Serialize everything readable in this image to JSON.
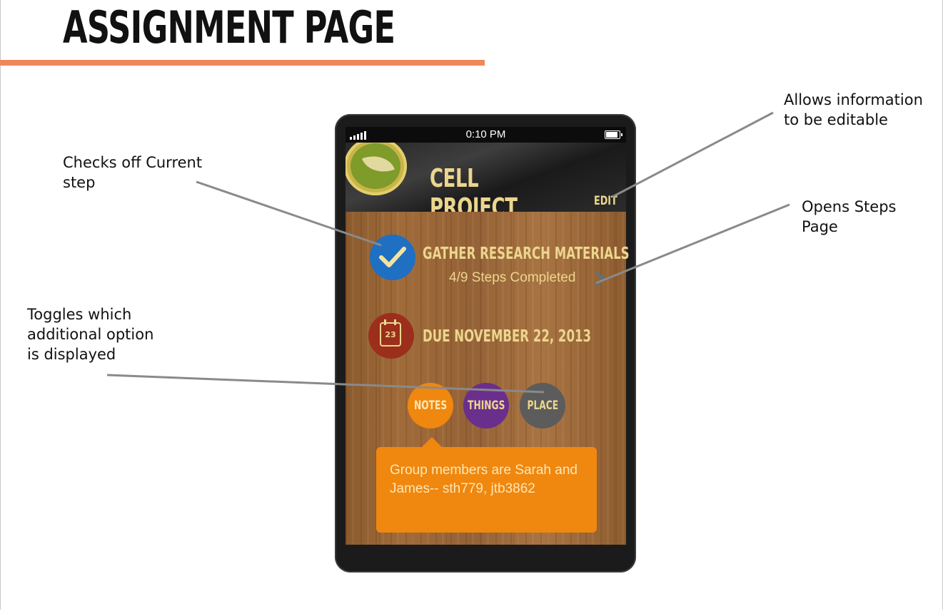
{
  "slide": {
    "title": "ASSIGNMENT PAGE",
    "accent_color": "#f0875a"
  },
  "annotations": {
    "check_step": "Checks off Current\nstep",
    "toggle_options": "Toggles which\nadditional option\nis displayed",
    "edit_info": "Allows information\nto be editable",
    "open_steps": "Opens Steps\nPage"
  },
  "phone": {
    "status_bar": {
      "time": "0:10 PM",
      "icons": [
        "signal-icon",
        "battery-icon"
      ]
    },
    "header": {
      "logo_icon": "leaf-icon",
      "title": "CELL PROJECT",
      "edit_label": "EDIT"
    },
    "current_step": {
      "icon": "check-icon",
      "name": "GATHER RESEARCH MATERIALS",
      "progress": "4/9 Steps Completed",
      "chevron_icon": "chevron-right-icon"
    },
    "due": {
      "calendar_day": "23",
      "text": "DUE NOVEMBER 22, 2013"
    },
    "options": [
      {
        "label": "NOTES",
        "color": "#f0870f",
        "selected": true
      },
      {
        "label": "THINGS",
        "color": "#6a2f8c",
        "selected": false
      },
      {
        "label": "PLACE",
        "color": "#5c5c5c",
        "selected": false
      }
    ],
    "notes_panel": {
      "text": "Group members are Sarah and James-- sth779, jtb3862"
    }
  }
}
